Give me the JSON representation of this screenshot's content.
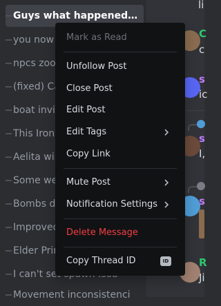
{
  "thread_list": {
    "items": [
      {
        "title": "Guys what happened to t...",
        "selected": true
      },
      {
        "title": "you now t"
      },
      {
        "title": "npcs zoon"
      },
      {
        "title": "(fixed) Ca"
      },
      {
        "title": "boat invis"
      },
      {
        "title": "This Iron"
      },
      {
        "title": "Aelita wil"
      },
      {
        "title": "Some we"
      },
      {
        "title": "Bombs do"
      },
      {
        "title": "Improved"
      },
      {
        "title": "Elder Prin"
      },
      {
        "title": "I can't set spawn .sob"
      },
      {
        "title": "Movement inconsistenci"
      }
    ]
  },
  "chat_strip": {
    "fragments": [
      "li",
      "C",
      "c",
      "s",
      "ic",
      "s",
      "I,",
      "s",
      "R",
      "Ji"
    ]
  },
  "context_menu": {
    "mark_as_read": "Mark as Read",
    "unfollow_post": "Unfollow Post",
    "close_post": "Close Post",
    "edit_post": "Edit Post",
    "edit_tags": "Edit Tags",
    "copy_link": "Copy Link",
    "mute_post": "Mute Post",
    "notification_settings": "Notification Settings",
    "delete_message": "Delete Message",
    "copy_thread_id": "Copy Thread ID",
    "id_badge": "ID"
  },
  "colors": {
    "sidebar_bg": "#2b2d31",
    "chat_bg": "#313338",
    "menu_bg": "#111214",
    "danger": "#f23f43",
    "disabled_text": "#6d6f78",
    "accent_teal": "#2dc770",
    "accent_purple": "#c27cfe"
  }
}
